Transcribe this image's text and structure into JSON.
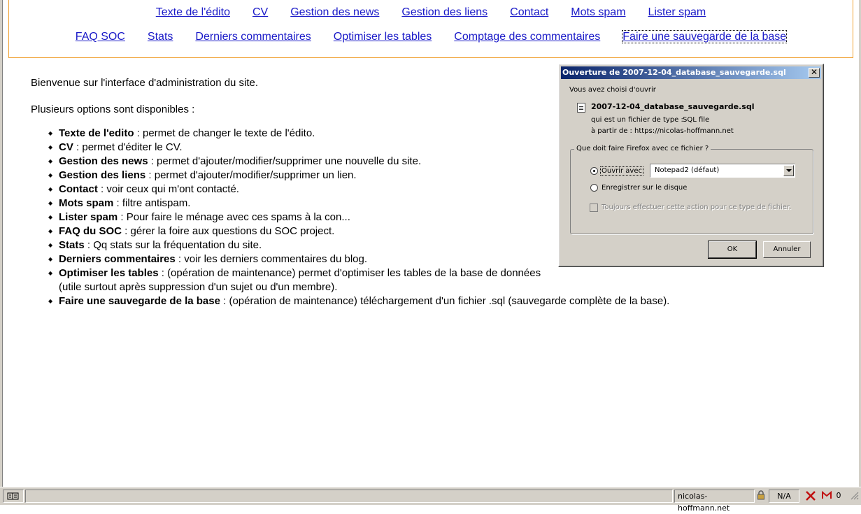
{
  "nav": {
    "row1": [
      "Texte de l'édito",
      "CV",
      "Gestion des news",
      "Gestion des liens",
      "Contact",
      "Mots spam",
      "Lister spam"
    ],
    "row2": [
      "FAQ SOC",
      "Stats",
      "Derniers commentaires",
      "Optimiser les tables",
      "Comptage des commentaires",
      "Faire une sauvegarde de la base"
    ]
  },
  "content": {
    "welcome": "Bienvenue sur l'interface d'administration du site.",
    "options_intro": "Plusieurs options sont disponibles :",
    "items": [
      {
        "term": "Texte de l'edito",
        "desc": " : permet de changer le texte de l'édito."
      },
      {
        "term": "CV",
        "desc": " : permet d'éditer le CV."
      },
      {
        "term": "Gestion des news",
        "desc": " : permet d'ajouter/modifier/supprimer une nouvelle du site."
      },
      {
        "term": "Gestion des liens",
        "desc": " : permet d'ajouter/modifier/supprimer un lien."
      },
      {
        "term": "Contact",
        "desc": " : voir ceux qui m'ont contacté."
      },
      {
        "term": "Mots spam",
        "desc": " : filtre antispam."
      },
      {
        "term": "Lister spam",
        "desc": " : Pour faire le ménage avec ces spams à la con..."
      },
      {
        "term": "FAQ du SOC",
        "desc": " : gérer la foire aux questions du SOC project."
      },
      {
        "term": "Stats",
        "desc": " : Qq stats sur la fréquentation du site."
      },
      {
        "term": "Derniers commentaires",
        "desc": " : voir les derniers commentaires du blog."
      },
      {
        "term": "Optimiser les tables",
        "desc": " : (opération de maintenance) permet d'optimiser les tables de la base de données",
        "desc2": "(utile surtout après suppression d'un sujet ou d'un membre)."
      },
      {
        "term": "Faire une sauvegarde de la base",
        "desc": " : (opération de maintenance) téléchargement d'un fichier .sql (sauvegarde complète de la base)."
      }
    ]
  },
  "dialog": {
    "title": "Ouverture de 2007-12-04_database_sauvegarde.sql",
    "chosen": "Vous avez choisi d'ouvrir",
    "filename": "2007-12-04_database_sauvegarde.sql",
    "type_label": "qui est un fichier de type :",
    "type_value": "SQL file",
    "from_label": "à partir de :",
    "from_value": "https://nicolas-hoffmann.net",
    "group_label": "Que doit faire Firefox avec ce fichier ?",
    "open_with_label": "Ouvrir avec",
    "open_with_value": "Notepad2 (défaut)",
    "save_label": "Enregistrer sur le disque",
    "always_label": "Toujours effectuer cette action pour ce type de fichier.",
    "ok_label": "OK",
    "cancel_label": "Annuler",
    "close_glyph": "✕"
  },
  "statusbar": {
    "domain": "nicolas-hoffmann.net",
    "na": "N/A",
    "mail_count": "0"
  }
}
